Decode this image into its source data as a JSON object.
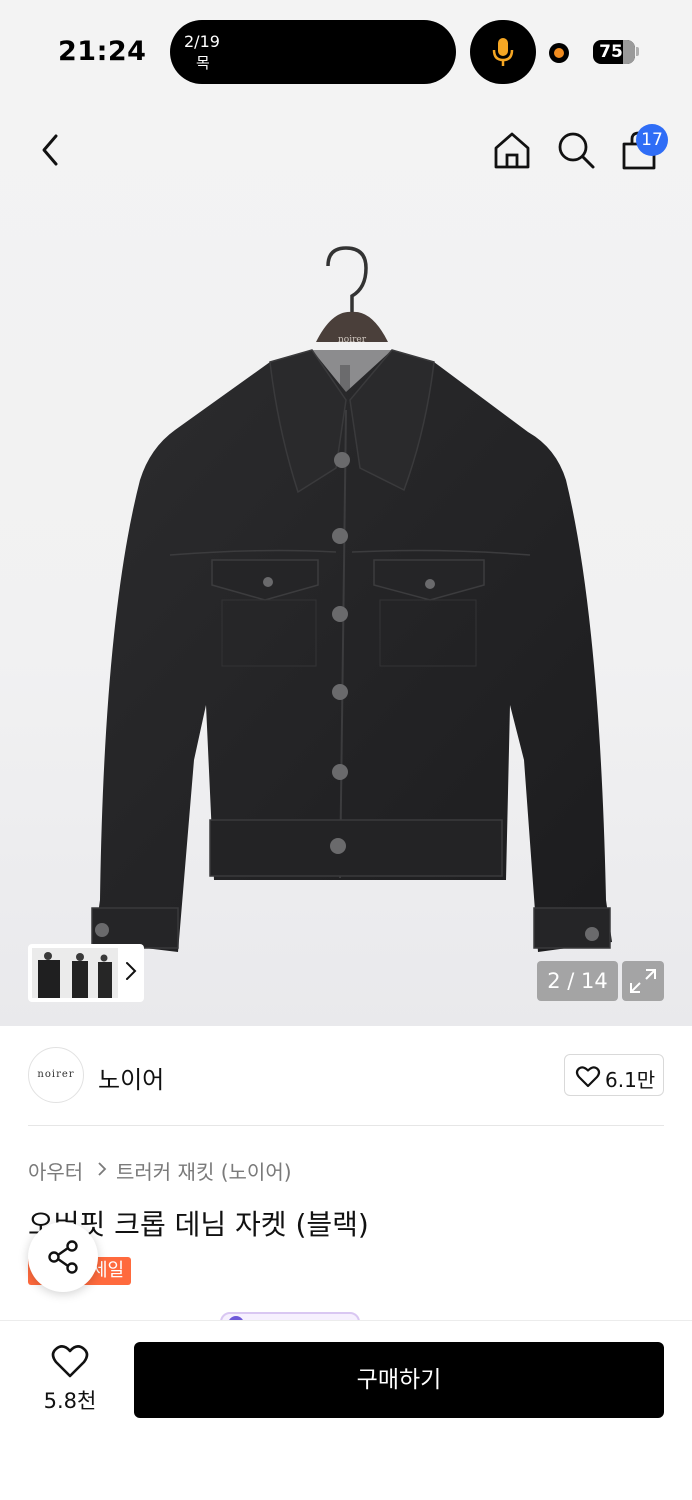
{
  "status_bar": {
    "time": "21:24",
    "island_date": "2/19",
    "island_day": "목",
    "battery": "75",
    "icons": [
      "microphone-icon",
      "recording-dot-icon",
      "battery-icon"
    ],
    "colors": {
      "mic": "#f5a623",
      "recording_dot": "#f28c1f"
    }
  },
  "header": {
    "icons": [
      "back-chevron-icon",
      "home-icon",
      "search-icon",
      "shopping-bag-icon"
    ],
    "cart_count": "17",
    "badge_color": "#2f6df6"
  },
  "gallery": {
    "jacket_label": "noirer",
    "page_counter": "2 / 14",
    "icons": [
      "thumbnail-strip",
      "chevron-right-icon",
      "expand-icon"
    ]
  },
  "brand": {
    "logo_text": "noirer",
    "name": "노이어",
    "likes": "6.1만"
  },
  "product": {
    "breadcrumb": [
      "아우터",
      "트러커 재킷 (노이어)"
    ],
    "title": "오버핏 크롭 데님 자켓 (블랙)",
    "badge": "세일",
    "badge_color": "#ff6a3d"
  },
  "bottom_bar": {
    "wish_count": "5.8천",
    "buy_label": "구매하기"
  }
}
